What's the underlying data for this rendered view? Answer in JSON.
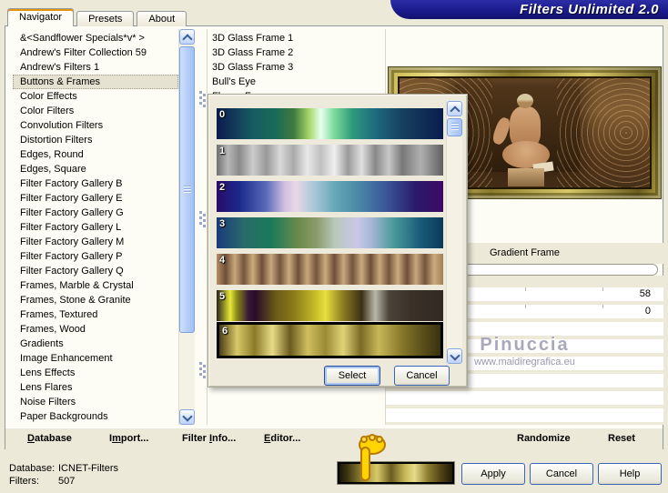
{
  "window": {
    "title": "Filters Unlimited 2.0"
  },
  "tabs": [
    {
      "label": "Navigator"
    },
    {
      "label": "Presets"
    },
    {
      "label": "About"
    }
  ],
  "navigator": {
    "selected_index": 3,
    "categories": [
      "&<Sandflower Specials*v* >",
      "Andrew's Filter Collection 59",
      "Andrew's Filters 1",
      "Buttons & Frames",
      "Color Effects",
      "Color Filters",
      "Convolution Filters",
      "Distortion Filters",
      "Edges, Round",
      "Edges, Square",
      "Filter Factory Gallery B",
      "Filter Factory Gallery E",
      "Filter Factory Gallery G",
      "Filter Factory Gallery L",
      "Filter Factory Gallery M",
      "Filter Factory Gallery P",
      "Filter Factory Gallery Q",
      "Frames, Marble & Crystal",
      "Frames, Stone & Granite",
      "Frames, Textured",
      "Frames, Wood",
      "Gradients",
      "Image Enhancement",
      "Lens Effects",
      "Lens Flares",
      "Noise Filters",
      "Paper Backgrounds"
    ]
  },
  "filter_list": [
    "3D Glass Frame 1",
    "3D Glass Frame 2",
    "3D Glass Frame 3",
    "Bull's Eye",
    "Flower Frame"
  ],
  "gradient_picker": {
    "selected_index": 6,
    "select_label": "Select",
    "cancel_label": "Cancel",
    "gradients": [
      {
        "label": "0",
        "stops": [
          "#0a1c4e 0%",
          "#123a58 8%",
          "#175c63 16%",
          "#1a6a57 26%",
          "#3e7a3e 34%",
          "#a8d86a 41%",
          "#e8fff0 46%",
          "#7ad89a 52%",
          "#2e9a7a 60%",
          "#1e6a80 70%",
          "#16405e 82%",
          "#0a1c4e 100%"
        ]
      },
      {
        "label": "1",
        "stops": [
          "#707070 0%",
          "#b8b8b8 5%",
          "#8a8a8a 10%",
          "#cccccc 16%",
          "#999999 22%",
          "#d8d8d8 28%",
          "#aaaaaa 34%",
          "#e8e8e8 40%",
          "#c0c0c0 46%",
          "#f0f0f0 52%",
          "#9a9a9a 58%",
          "#e0e0e0 64%",
          "#888888 70%",
          "#c8c8c8 76%",
          "#787878 82%",
          "#b0b0b0 90%",
          "#606060 100%"
        ]
      },
      {
        "label": "2",
        "stops": [
          "#2a0a6a 0%",
          "#1a2a8a 10%",
          "#5a6ab8 22%",
          "#d0c0e0 30%",
          "#e8d8e8 35%",
          "#a8c8d8 43%",
          "#68a8b8 52%",
          "#4a8aa8 62%",
          "#3a5a9a 74%",
          "#2a1a6a 88%",
          "#3c0a64 100%"
        ]
      },
      {
        "label": "3",
        "stops": [
          "#1a3a7a 0%",
          "#2a6a6a 12%",
          "#1a7a5a 24%",
          "#6a8a4a 36%",
          "#8a9a6a 44%",
          "#b8c8b8 52%",
          "#c8c8e8 62%",
          "#a8b8d8 68%",
          "#4a9a9a 78%",
          "#1a5a7a 90%",
          "#0a3a5a 100%"
        ]
      },
      {
        "label": "4",
        "stops": [
          "#b89068 0%",
          "#6e4e38 4%",
          "#c8a87a 8%",
          "#74543e 12%",
          "#cbab7d 16%",
          "#6e4e38 20%",
          "#c8a87a 24%",
          "#74543e 28%",
          "#cbab7d 32%",
          "#6e4e38 36%",
          "#c8a87a 40%",
          "#74543e 44%",
          "#cbab7d 48%",
          "#6e4e38 52%",
          "#c8a87a 56%",
          "#74543e 60%",
          "#cbab7d 64%",
          "#6e4e38 68%",
          "#c8a87a 72%",
          "#74543e 76%",
          "#cbab7d 80%",
          "#6e4e38 84%",
          "#c8a87a 88%",
          "#74543e 92%",
          "#cbab7d 96%",
          "#a08058 100%"
        ]
      },
      {
        "label": "5",
        "stops": [
          "#2a2418 0%",
          "#e8e838 6%",
          "#8a8818 9%",
          "#3a1838 14%",
          "#2a0a2a 17%",
          "#6a5a18 26%",
          "#8a7a1a 34%",
          "#c8c028 44%",
          "#e8e040 48%",
          "#8a7a20 56%",
          "#3a3018 64%",
          "#b8b8a8 70%",
          "#4a4438 76%",
          "#3a3028 86%",
          "#322a22 100%"
        ]
      },
      {
        "label": "6",
        "stops": [
          "#4a3e14 0%",
          "#d8c868 8%",
          "#8a7a2a 16%",
          "#e8dc88 24%",
          "#6a5a1e 32%",
          "#d0c060 40%",
          "#9a8a34 48%",
          "#e0d478 56%",
          "#7a6a24 64%",
          "#c8b858 72%",
          "#8a7a2c 82%",
          "#5a4e1a 92%",
          "#3a3210 100%"
        ]
      }
    ]
  },
  "filter_panel": {
    "name": "Gradient Frame",
    "params": [
      {
        "value": "58",
        "ticks": true
      },
      {
        "value": "0",
        "ticks": true
      },
      {
        "value": ""
      },
      {
        "value": ""
      },
      {
        "value": ""
      },
      {
        "value": ""
      },
      {
        "value": ""
      },
      {
        "value": ""
      }
    ],
    "watermark_line1": "Pinuccia",
    "watermark_line2": "www.maidiregrafica.eu"
  },
  "toolbar": {
    "database": {
      "pre": "",
      "key": "D",
      "post": "atabase"
    },
    "import": {
      "pre": "I",
      "key": "m",
      "post": "port..."
    },
    "filter_info": {
      "pre": "Filter ",
      "key": "I",
      "post": "nfo..."
    },
    "editor": {
      "pre": "",
      "key": "E",
      "post": "ditor..."
    },
    "randomize": "Randomize",
    "reset": "Reset"
  },
  "status": {
    "database_label": "Database:",
    "database_value": "ICNET-Filters",
    "filters_label": "Filters:",
    "filters_value": "507"
  },
  "footer": {
    "apply": "Apply",
    "cancel": "Cancel",
    "help": "Help"
  },
  "colors": {
    "banner_navy": "#1b1b8e",
    "dialog_beige": "#ece9d8",
    "selection_border": "#000000"
  },
  "current_gradient_stops": [
    "#141004 0%",
    "#3a3210 8%",
    "#9a8a38 22%",
    "#d8c868 34%",
    "#6a5c20 46%",
    "#c8b858 58%",
    "#e8dc88 66%",
    "#8a7a2c 78%",
    "#4a3e14 90%",
    "#1a1608 100%"
  ]
}
